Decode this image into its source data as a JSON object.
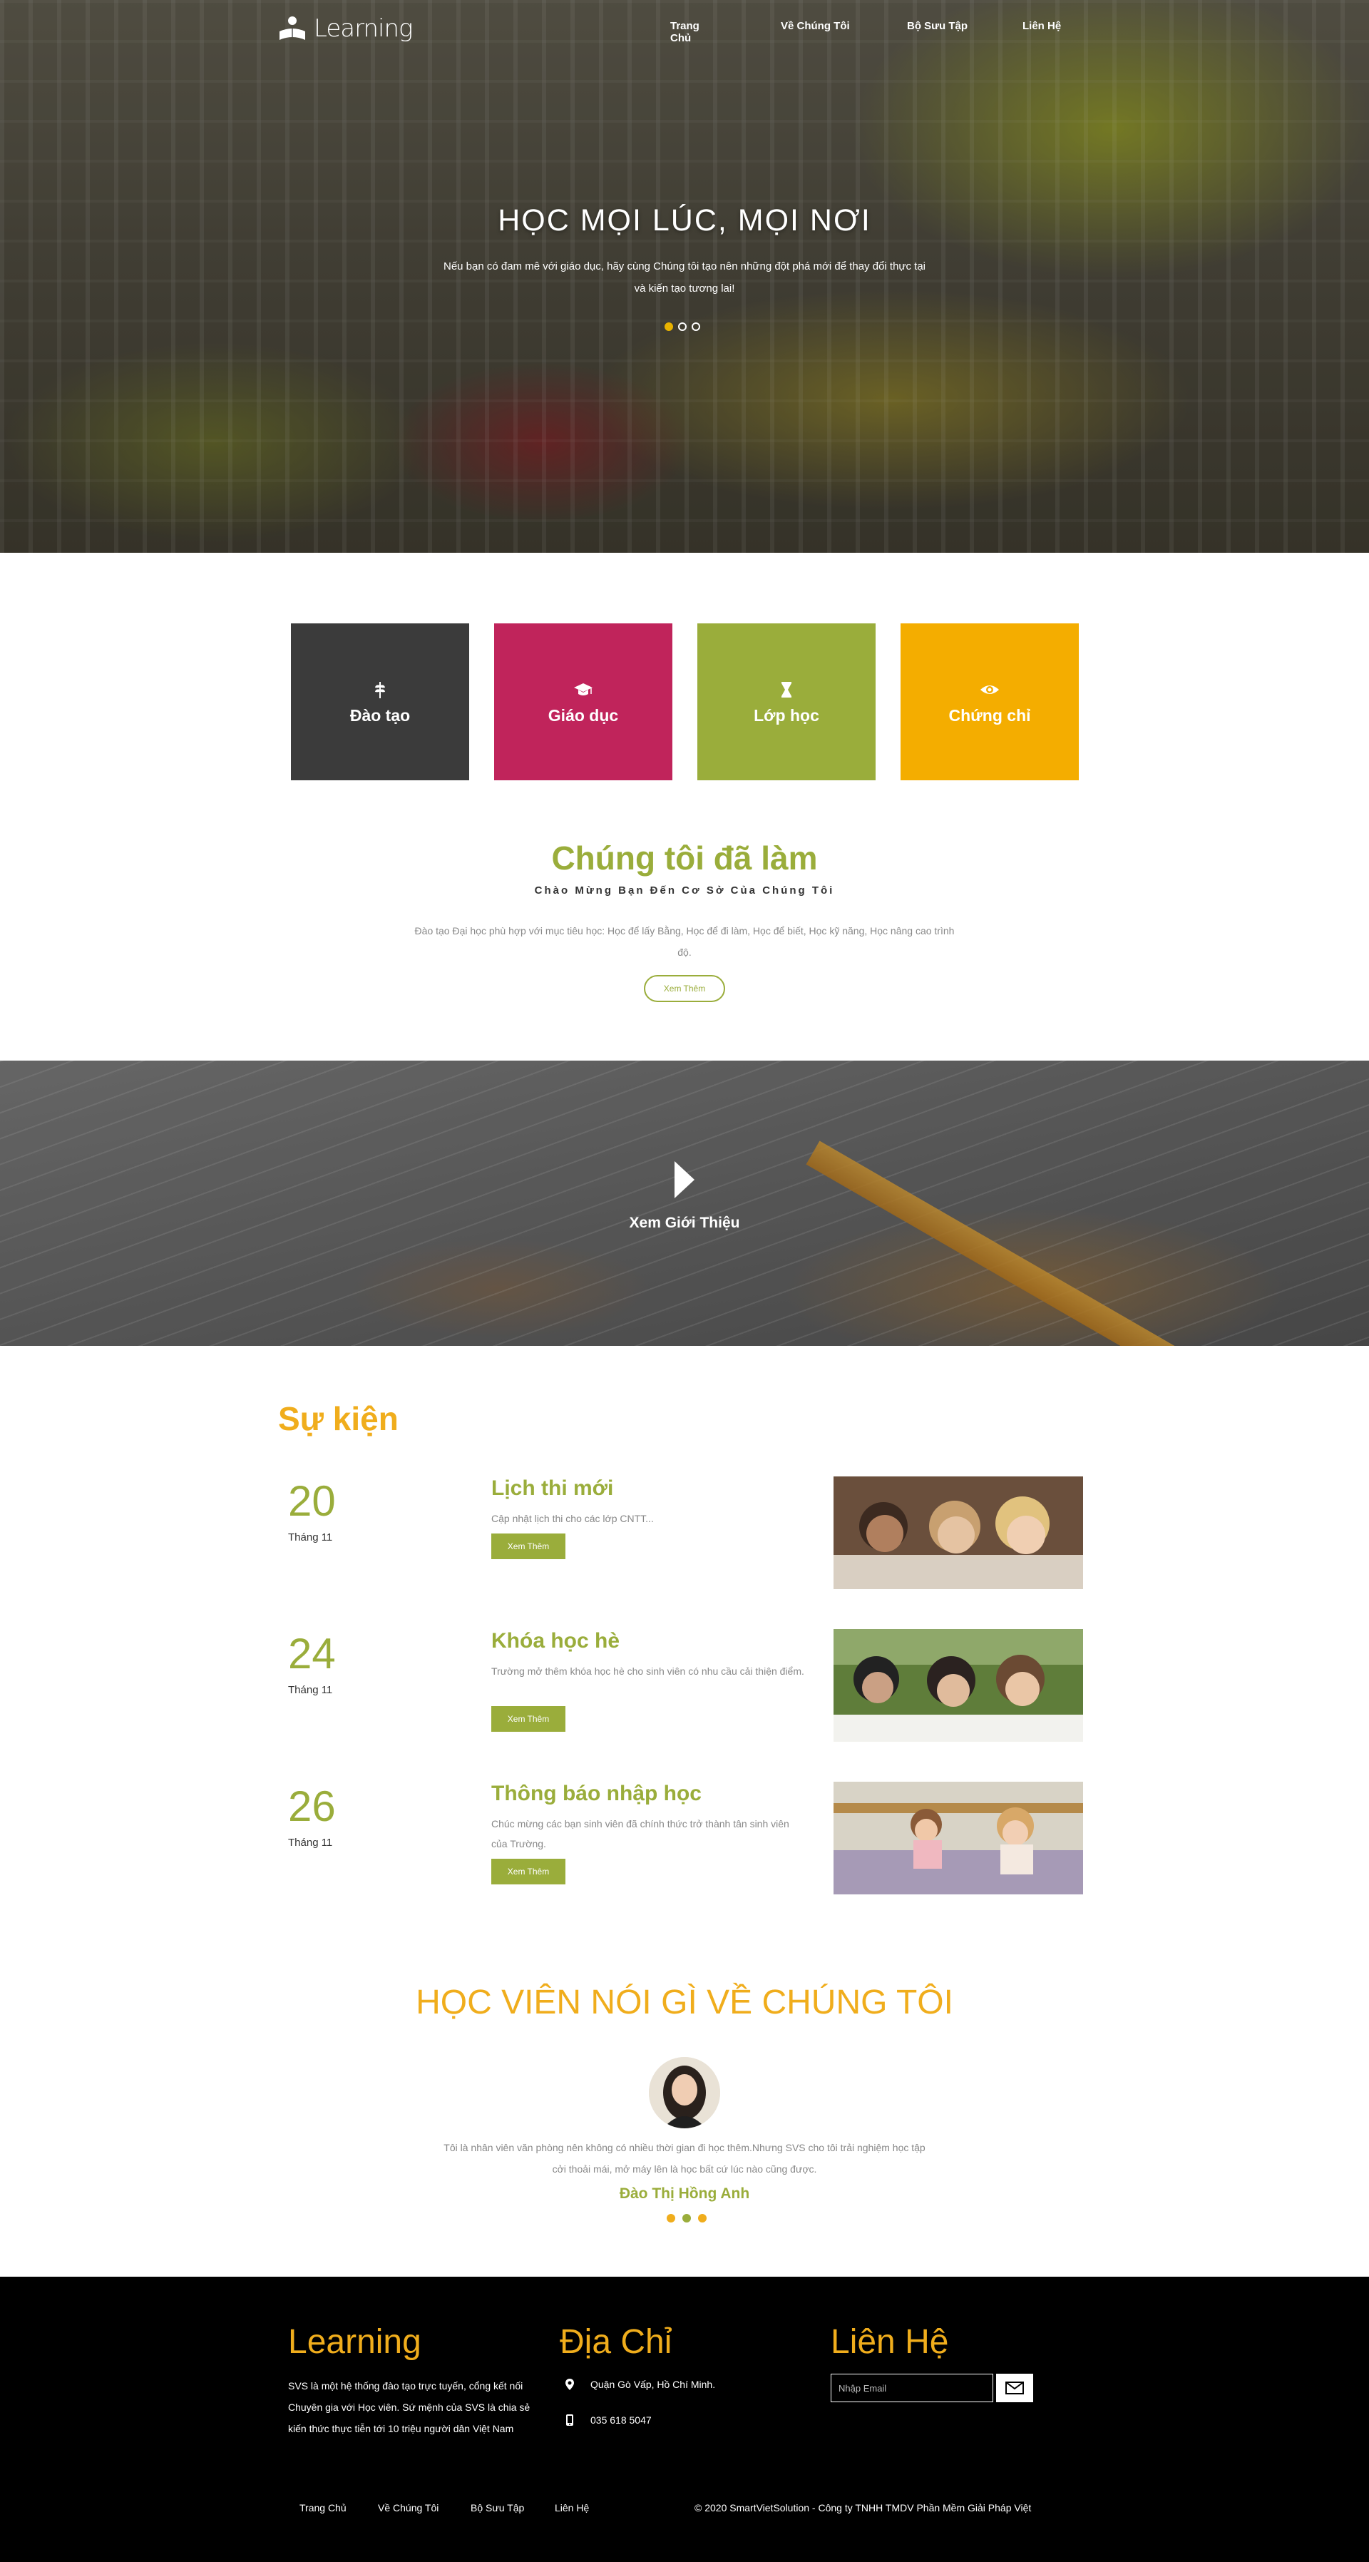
{
  "header": {
    "logo_text": "Learning",
    "nav": [
      "Trang Chủ",
      "Về Chúng Tôi",
      "Bộ Sưu Tập",
      "Liên Hệ"
    ]
  },
  "hero": {
    "title": "HỌC MỌI LÚC, MỌI NƠI",
    "subtitle": "Nếu bạn có đam mê với giáo dục, hãy cùng Chúng tôi tạo nên những đột phá mới để thay đổi thực tại và kiến tạo tương lai!",
    "slide_count": 3,
    "active_slide": 1
  },
  "features": [
    {
      "label": "Đào tạo",
      "icon": "wheat-icon",
      "color": "#3b3b3b"
    },
    {
      "label": "Giáo dục",
      "icon": "graduation-cap-icon",
      "color": "#c0245b"
    },
    {
      "label": "Lớp học",
      "icon": "hourglass-icon",
      "color": "#9aad3b"
    },
    {
      "label": "Chứng chỉ",
      "icon": "eye-icon",
      "color": "#f4ad00"
    }
  ],
  "about": {
    "title": "Chúng tôi đã làm",
    "subtitle": "Chào Mừng Bạn Đến Cơ Sở Của Chúng Tôi",
    "description": "Đào tạo Đại học phù hợp với mục tiêu học: Học để lấy Bằng, Học để đi làm, Học để biết, Học kỹ năng, Học nâng cao trình độ.",
    "button": "Xem Thêm"
  },
  "video": {
    "label": "Xem Giới Thiệu",
    "icon": "play-icon"
  },
  "events": {
    "title": "Sự kiện",
    "items": [
      {
        "day": "20",
        "month": "Tháng 11",
        "title": "Lịch thi mới",
        "desc": "Cập nhật lịch thi cho các lớp CNTT...",
        "button": "Xem Thêm"
      },
      {
        "day": "24",
        "month": "Tháng 11",
        "title": "Khóa học hè",
        "desc": "Trường mở thêm khóa học hè cho sinh viên có nhu cầu cải thiện điểm.",
        "button": "Xem Thêm"
      },
      {
        "day": "26",
        "month": "Tháng 11",
        "title": "Thông báo nhập học",
        "desc": "Chúc mừng các bạn sinh viên đã chính thức trở thành tân sinh viên của Trường.",
        "button": "Xem Thêm"
      }
    ]
  },
  "testimonial": {
    "title": "HỌC VIÊN NÓI GÌ VỀ CHÚNG TÔI",
    "text": "Tôi là nhân viên văn phòng nên không có nhiều thời gian đi học thêm.Nhưng SVS cho tôi trải nghiệm học tập cởi thoải mái, mở máy lên là học bất cứ lúc nào cũng được.",
    "name": "Đào Thị Hồng Anh",
    "dot_count": 3,
    "active_dot": 1
  },
  "footer": {
    "about_title": "Learning",
    "about_text": "SVS là một hệ thống đào tạo trực tuyến, cổng kết nối Chuyên gia với Học viên. Sứ mệnh của SVS là chia sẻ kiến thức thực tiễn tới 10 triệu người dân Việt Nam",
    "address_title": "Địa Chỉ",
    "address": "Quận Gò Vấp, Hồ Chí Minh.",
    "phone": "035 618 5047",
    "contact_title": "Liên Hệ",
    "email_placeholder": "Nhập Email",
    "links": [
      "Trang Chủ",
      "Về Chúng Tôi",
      "Bộ Sưu Tập",
      "Liên Hệ"
    ],
    "copyright": "© 2020 SmartVietSolution - Công ty TNHH TMDV Phần Mềm Giải Pháp Việt"
  }
}
